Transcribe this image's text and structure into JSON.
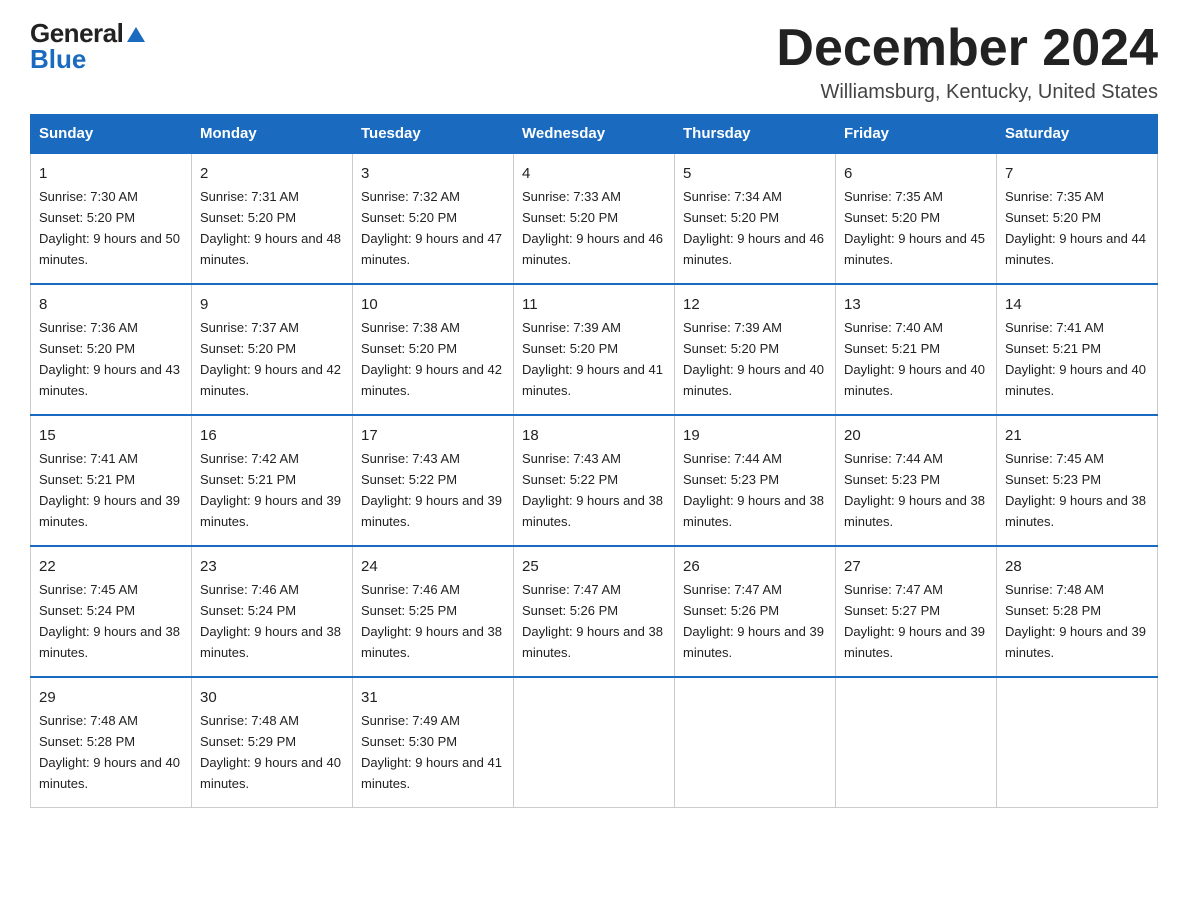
{
  "logo": {
    "general": "General",
    "blue": "Blue"
  },
  "title": "December 2024",
  "subtitle": "Williamsburg, Kentucky, United States",
  "days_of_week": [
    "Sunday",
    "Monday",
    "Tuesday",
    "Wednesday",
    "Thursday",
    "Friday",
    "Saturday"
  ],
  "weeks": [
    [
      {
        "day": "1",
        "sunrise": "7:30 AM",
        "sunset": "5:20 PM",
        "daylight": "9 hours and 50 minutes."
      },
      {
        "day": "2",
        "sunrise": "7:31 AM",
        "sunset": "5:20 PM",
        "daylight": "9 hours and 48 minutes."
      },
      {
        "day": "3",
        "sunrise": "7:32 AM",
        "sunset": "5:20 PM",
        "daylight": "9 hours and 47 minutes."
      },
      {
        "day": "4",
        "sunrise": "7:33 AM",
        "sunset": "5:20 PM",
        "daylight": "9 hours and 46 minutes."
      },
      {
        "day": "5",
        "sunrise": "7:34 AM",
        "sunset": "5:20 PM",
        "daylight": "9 hours and 46 minutes."
      },
      {
        "day": "6",
        "sunrise": "7:35 AM",
        "sunset": "5:20 PM",
        "daylight": "9 hours and 45 minutes."
      },
      {
        "day": "7",
        "sunrise": "7:35 AM",
        "sunset": "5:20 PM",
        "daylight": "9 hours and 44 minutes."
      }
    ],
    [
      {
        "day": "8",
        "sunrise": "7:36 AM",
        "sunset": "5:20 PM",
        "daylight": "9 hours and 43 minutes."
      },
      {
        "day": "9",
        "sunrise": "7:37 AM",
        "sunset": "5:20 PM",
        "daylight": "9 hours and 42 minutes."
      },
      {
        "day": "10",
        "sunrise": "7:38 AM",
        "sunset": "5:20 PM",
        "daylight": "9 hours and 42 minutes."
      },
      {
        "day": "11",
        "sunrise": "7:39 AM",
        "sunset": "5:20 PM",
        "daylight": "9 hours and 41 minutes."
      },
      {
        "day": "12",
        "sunrise": "7:39 AM",
        "sunset": "5:20 PM",
        "daylight": "9 hours and 40 minutes."
      },
      {
        "day": "13",
        "sunrise": "7:40 AM",
        "sunset": "5:21 PM",
        "daylight": "9 hours and 40 minutes."
      },
      {
        "day": "14",
        "sunrise": "7:41 AM",
        "sunset": "5:21 PM",
        "daylight": "9 hours and 40 minutes."
      }
    ],
    [
      {
        "day": "15",
        "sunrise": "7:41 AM",
        "sunset": "5:21 PM",
        "daylight": "9 hours and 39 minutes."
      },
      {
        "day": "16",
        "sunrise": "7:42 AM",
        "sunset": "5:21 PM",
        "daylight": "9 hours and 39 minutes."
      },
      {
        "day": "17",
        "sunrise": "7:43 AM",
        "sunset": "5:22 PM",
        "daylight": "9 hours and 39 minutes."
      },
      {
        "day": "18",
        "sunrise": "7:43 AM",
        "sunset": "5:22 PM",
        "daylight": "9 hours and 38 minutes."
      },
      {
        "day": "19",
        "sunrise": "7:44 AM",
        "sunset": "5:23 PM",
        "daylight": "9 hours and 38 minutes."
      },
      {
        "day": "20",
        "sunrise": "7:44 AM",
        "sunset": "5:23 PM",
        "daylight": "9 hours and 38 minutes."
      },
      {
        "day": "21",
        "sunrise": "7:45 AM",
        "sunset": "5:23 PM",
        "daylight": "9 hours and 38 minutes."
      }
    ],
    [
      {
        "day": "22",
        "sunrise": "7:45 AM",
        "sunset": "5:24 PM",
        "daylight": "9 hours and 38 minutes."
      },
      {
        "day": "23",
        "sunrise": "7:46 AM",
        "sunset": "5:24 PM",
        "daylight": "9 hours and 38 minutes."
      },
      {
        "day": "24",
        "sunrise": "7:46 AM",
        "sunset": "5:25 PM",
        "daylight": "9 hours and 38 minutes."
      },
      {
        "day": "25",
        "sunrise": "7:47 AM",
        "sunset": "5:26 PM",
        "daylight": "9 hours and 38 minutes."
      },
      {
        "day": "26",
        "sunrise": "7:47 AM",
        "sunset": "5:26 PM",
        "daylight": "9 hours and 39 minutes."
      },
      {
        "day": "27",
        "sunrise": "7:47 AM",
        "sunset": "5:27 PM",
        "daylight": "9 hours and 39 minutes."
      },
      {
        "day": "28",
        "sunrise": "7:48 AM",
        "sunset": "5:28 PM",
        "daylight": "9 hours and 39 minutes."
      }
    ],
    [
      {
        "day": "29",
        "sunrise": "7:48 AM",
        "sunset": "5:28 PM",
        "daylight": "9 hours and 40 minutes."
      },
      {
        "day": "30",
        "sunrise": "7:48 AM",
        "sunset": "5:29 PM",
        "daylight": "9 hours and 40 minutes."
      },
      {
        "day": "31",
        "sunrise": "7:49 AM",
        "sunset": "5:30 PM",
        "daylight": "9 hours and 41 minutes."
      },
      null,
      null,
      null,
      null
    ]
  ]
}
